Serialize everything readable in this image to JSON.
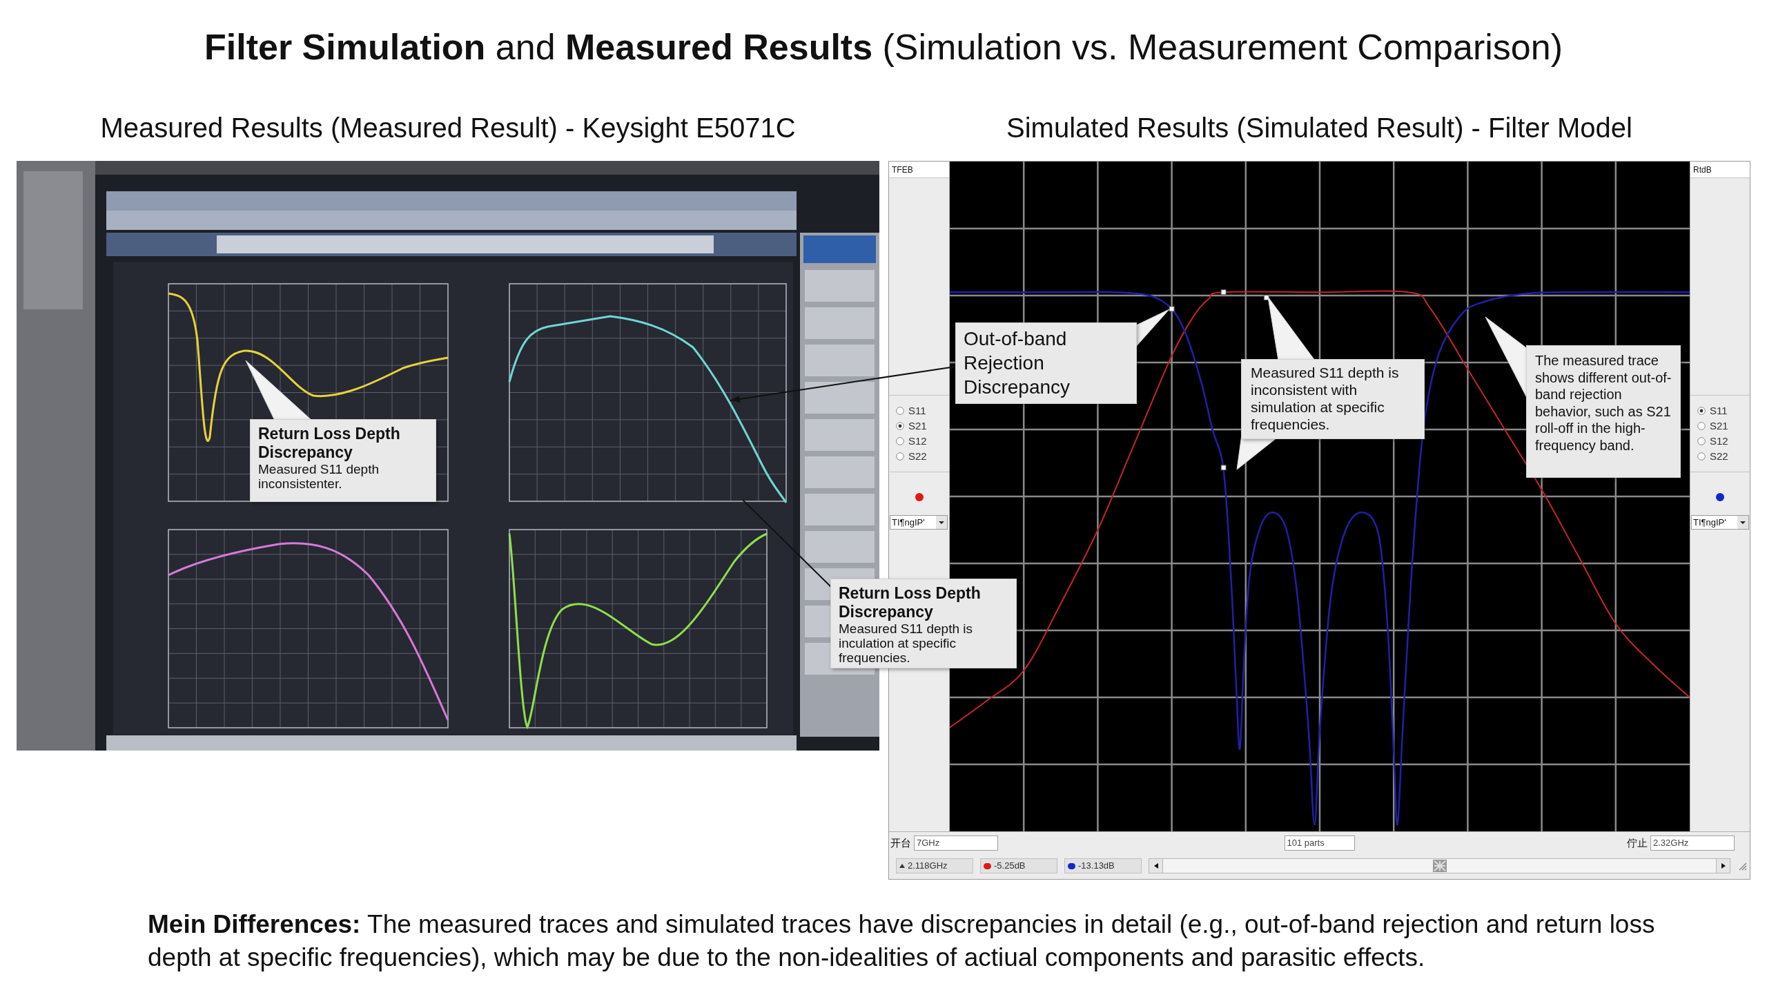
{
  "title": "**Filter Simulation** and **Measured Results** (Simulation vs. Measurement Comparison)",
  "measured": {
    "heading": "Measured Results (Measured Result) - Keysight E5071C",
    "callouts": [
      {
        "kind": "titled",
        "title": "Return Loss Depth Discrepancy",
        "text": "Measured S11 depth inconsistenter."
      }
    ]
  },
  "simulated": {
    "heading": "Simulated Results (Simulated Result) - Filter Model",
    "left_panel": {
      "label": "TFEB",
      "params": [
        {
          "label": "S11",
          "selected": false
        },
        {
          "label": "S21",
          "selected": true
        },
        {
          "label": "S12",
          "selected": false
        },
        {
          "label": "S22",
          "selected": false
        }
      ],
      "color": "#e01818",
      "dropdown": "TI¶ngIP'"
    },
    "right_panel": {
      "label": "RtdB",
      "params": [
        {
          "label": "S11",
          "selected": true
        },
        {
          "label": "S21",
          "selected": false
        },
        {
          "label": "S12",
          "selected": false
        },
        {
          "label": "S22",
          "selected": false
        }
      ],
      "color": "#1428c8",
      "dropdown": "TI¶ngIP'"
    },
    "callouts": [
      {
        "kind": "plain",
        "text": "Out-of-band Rejection Discrepancy"
      },
      {
        "kind": "plain",
        "text": "Measured S11 depth is inconsistent with simulation at specific frequencies."
      },
      {
        "kind": "plain",
        "text": "The measured trace shows different out-of-band rejection behavior, such as S21 roll-off in the high-frequency band."
      },
      {
        "kind": "titled",
        "title": "Return Loss Depth Discrepancy",
        "text": "Measured S11 depth is inculation at specific frequencies."
      }
    ],
    "start": {
      "label": "开台",
      "value": "7GHz"
    },
    "points": "101 parts",
    "stop": {
      "label": "佇止",
      "value": "2.32GHz"
    },
    "readouts": [
      {
        "kind": "frequency",
        "text": "2.118GHz"
      },
      {
        "kind": "level",
        "text": "-5.25dB",
        "color": "#e01818"
      },
      {
        "kind": "level",
        "text": "-13.13dB",
        "color": "#1428c8"
      }
    ]
  },
  "summary": "**Mein Differences:** The measured traces and simulated traces have discrepancies in detail (e.g., out-of-band rejection and return loss depth at specific frequencies), which may be due to the non-idealities of actiual components and parasitic effects."
}
